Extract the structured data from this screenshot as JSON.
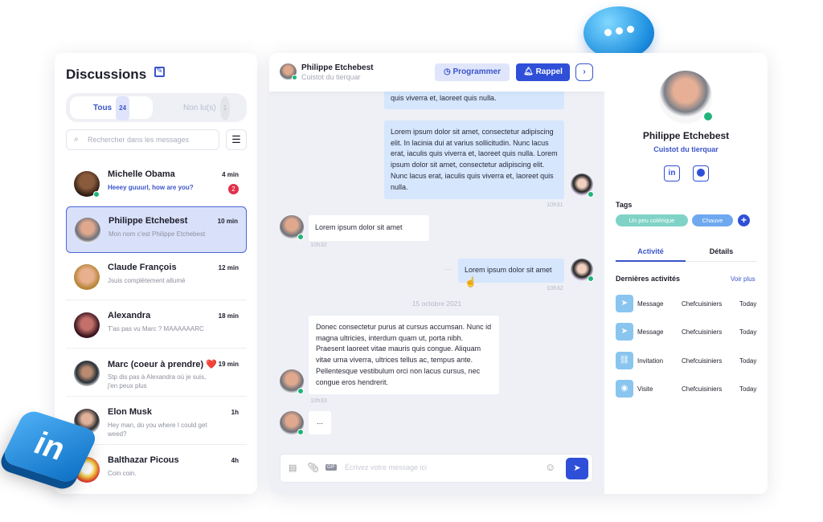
{
  "discussions": {
    "title": "Discussions",
    "tabs": [
      {
        "label": "Tous",
        "count": "24"
      },
      {
        "label": "Non lu(s)",
        "count": "1"
      }
    ],
    "search_placeholder": "Rechercher dans les messages",
    "conversations": [
      {
        "name": "Michelle Obama",
        "time": "4 min",
        "preview": "Heeey guuurl, how are you?",
        "unread": "2"
      },
      {
        "name": "Philippe Etchebest",
        "time": "10 min",
        "preview": "Mon nom c'est Philippe Etchebest"
      },
      {
        "name": "Claude François",
        "time": "12 min",
        "preview": "Jsuis complètement allumé"
      },
      {
        "name": "Alexandra",
        "time": "18 min",
        "preview": "T'as pas vu Marc ? MAAAAAARC"
      },
      {
        "name": "Marc (coeur à prendre) ❤️",
        "time": "19 min",
        "preview": "Stp dis pas à Alexandra où je suis, j'en peux plus"
      },
      {
        "name": "Elon Musk",
        "time": "1h",
        "preview": "Hey man, do you where I could get weed?"
      },
      {
        "name": "Balthazar Picous",
        "time": "4h",
        "preview": "Coin coin."
      }
    ]
  },
  "chat": {
    "contact_name": "Philippe Etchebest",
    "contact_subtitle": "Cuistot du tierquar",
    "schedule_label": "Programmer",
    "reminder_label": "Rappel",
    "messages": [
      {
        "text": "consectetur adipiscing elit. Nunc lacus erat, iaculis quis viverra et, laoreet quis nulla."
      },
      {
        "text": "Lorem ipsum dolor sit amet, consectetur adipiscing elit. In lacinia dui at varius sollicitudin. Nunc lacus erat, iaculis quis viverra et, laoreet quis nulla. Lorem ipsum dolor sit amet, consectetur adipiscing elit. Nunc lacus erat, iaculis quis viverra et, laoreet quis nulla.",
        "time": "10h31"
      },
      {
        "text": "Lorem ipsum dolor sit amet",
        "time": "10h32"
      },
      {
        "text": "Lorem ipsum dolor sit amet",
        "time": "10h32",
        "more": "···"
      },
      {
        "text": "Donec consectetur purus at cursus accumsan. Nunc id magna ultricies, interdum quam ut, porta nibh. Praesent laoreet vitae mauris quis congue. Aliquam vitae urna viverra, ultrices tellus ac, tempus ante. Pellentesque vestibulum orci non lacus cursus, nec congue eros hendrerit.",
        "time": "10h33"
      },
      {
        "text": "..."
      }
    ],
    "date_separator": "15 octobre 2021",
    "input_placeholder": "Écrivez votre message ici",
    "gif_label": "GIF"
  },
  "profile": {
    "name": "Philippe Etchebest",
    "subtitle": "Cuistot du tierquar",
    "tags_title": "Tags",
    "tags": [
      {
        "label": "Un peu colérique",
        "color": "#7fd3c6"
      },
      {
        "label": "Chauve",
        "color": "#6ea8ef"
      }
    ],
    "tabs": [
      "Activité",
      "Détails"
    ],
    "activities_title": "Dernières activités",
    "see_more": "Voir plus",
    "activities": [
      {
        "type": "Message",
        "group": "Chefcuisiniers",
        "date": "Today",
        "icon": "send-icon"
      },
      {
        "type": "Message",
        "group": "Chefcuisiniers",
        "date": "Today",
        "icon": "send-icon"
      },
      {
        "type": "Invitation",
        "group": "Chefcuisiniers",
        "date": "Today",
        "icon": "link-icon"
      },
      {
        "type": "Visite",
        "group": "Chefcuisiniers",
        "date": "Today",
        "icon": "eye-icon"
      }
    ]
  },
  "colors": {
    "accent": "#2f4fd8",
    "online": "#1fb57a",
    "unread": "#e2304a",
    "sent_bubble": "#d5e6fd"
  }
}
